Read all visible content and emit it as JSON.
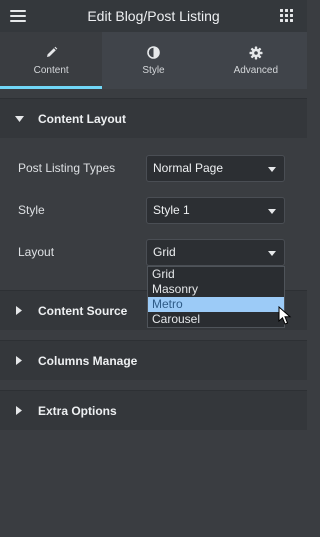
{
  "header": {
    "title": "Edit Blog/Post Listing",
    "left_icon": "hamburger-menu-icon",
    "right_icon": "apps-grid-icon"
  },
  "tabs": [
    {
      "label": "Content",
      "icon": "pencil-icon",
      "active": true
    },
    {
      "label": "Style",
      "icon": "half-circle-contrast-icon",
      "active": false
    },
    {
      "label": "Advanced",
      "icon": "gear-icon",
      "active": false
    }
  ],
  "content_layout": {
    "title": "Content Layout",
    "expanded": true,
    "fields": [
      {
        "label": "Post Listing Types",
        "value": "Normal Page"
      },
      {
        "label": "Style",
        "value": "Style 1"
      },
      {
        "label": "Layout",
        "value": "Grid"
      }
    ],
    "layout_dropdown": {
      "options": [
        "Grid",
        "Masonry",
        "Metro",
        "Carousel"
      ],
      "highlighted": "Metro"
    }
  },
  "sections": [
    {
      "title": "Content Source"
    },
    {
      "title": "Columns Manage"
    },
    {
      "title": "Extra Options"
    }
  ],
  "colors": {
    "accent": "#71d7f7",
    "highlight": "#9ccbf7",
    "panel": "#3a3d41",
    "section_header": "#34373b"
  }
}
